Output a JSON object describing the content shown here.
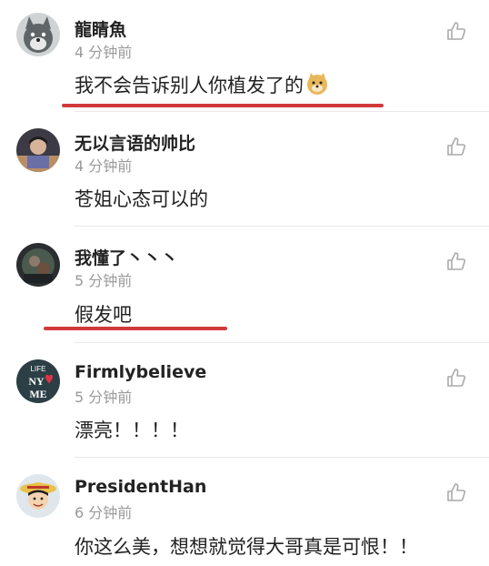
{
  "comments": [
    {
      "username": "龍睛魚",
      "time": "4 分钟前",
      "text": "我不会告诉别人你植发了的",
      "avatar": "cartoon-wolf-avatar"
    },
    {
      "username": "无以言语的帅比",
      "time": "4 分钟前",
      "text": "苍姐心态可以的",
      "avatar": "photo-avatar"
    },
    {
      "username": "我懂了丶丶丶",
      "time": "5 分钟前",
      "text": "假发吧",
      "avatar": "photo-avatar"
    },
    {
      "username": "Firmlybelieve",
      "time": "5 分钟前",
      "text": "漂亮！！！！",
      "avatar": "life-ny-me-avatar"
    },
    {
      "username": "PresidentHan",
      "time": "6 分钟前",
      "text": "你这么美，想想就觉得大哥真是可恨！！",
      "avatar": "cartoon-luffy-avatar"
    }
  ],
  "icons": {
    "like": "thumbs-up-icon",
    "emoji": "doge-emoji-icon"
  },
  "colors": {
    "underline": "#d23a3a",
    "time": "#9a9a9a",
    "divider": "#e9e9e9"
  }
}
